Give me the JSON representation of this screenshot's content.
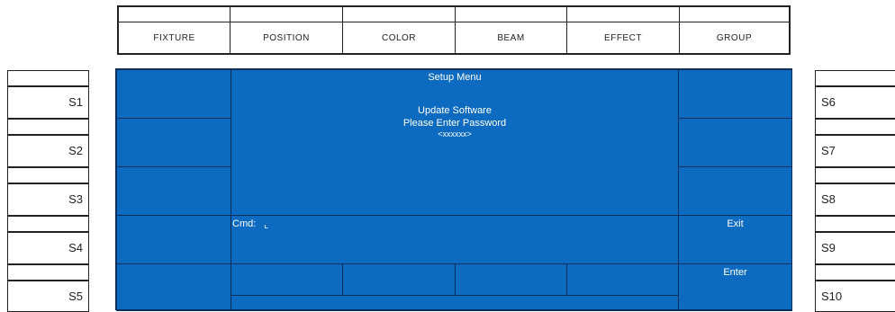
{
  "tabs": [
    "FIXTURE",
    "POSITION",
    "COLOR",
    "BEAM",
    "EFFECT",
    "GROUP"
  ],
  "left_keys": [
    "S1",
    "S2",
    "S3",
    "S4",
    "S5"
  ],
  "right_keys": [
    "S6",
    "S7",
    "S8",
    "S9",
    "S10"
  ],
  "screen": {
    "title": "Setup Menu",
    "line1": "Update Software",
    "line2": "Please Enter Password",
    "line3": "<xxxxxx>",
    "cmd_label": "Cmd:",
    "cursor_glyph": "⌞",
    "exit_label": "Exit",
    "enter_label": "Enter"
  },
  "colors": {
    "screen_blue": "#0c6bc0",
    "grid_line": "#0a2e5b"
  }
}
